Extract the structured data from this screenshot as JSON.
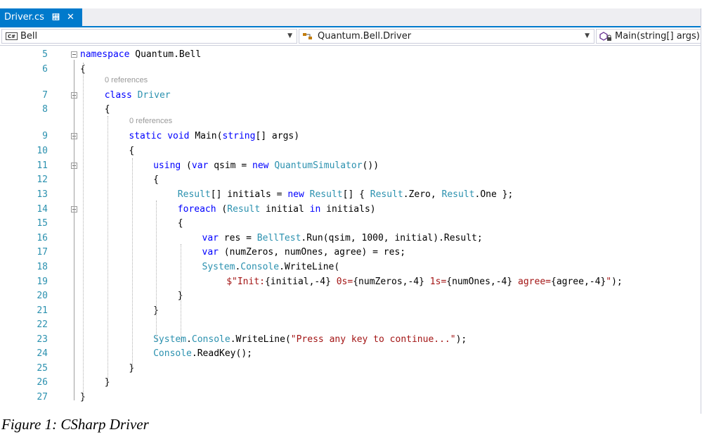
{
  "tab": {
    "label": "Driver.cs",
    "pin_icon": "pin-icon",
    "close_icon": "close-icon"
  },
  "navbar": {
    "project": "Bell",
    "project_icon": "csharp-project-icon",
    "class": "Quantum.Bell.Driver",
    "class_icon": "class-icon",
    "member": "Main(string[] args)",
    "member_icon": "method-icon"
  },
  "references": [
    "0 references",
    "0 references"
  ],
  "lines": [
    {
      "num": "5",
      "tokens": [
        {
          "t": "namespace",
          "c": "kw"
        },
        {
          "t": " Quantum.Bell"
        }
      ]
    },
    {
      "num": "6",
      "tokens": [
        {
          "t": "{"
        }
      ]
    },
    {
      "num": "7",
      "tokens": [
        {
          "t": "class",
          "c": "kw"
        },
        {
          "t": " "
        },
        {
          "t": "Driver",
          "c": "ty"
        }
      ]
    },
    {
      "num": "8",
      "tokens": [
        {
          "t": "{"
        }
      ]
    },
    {
      "num": "9",
      "tokens": [
        {
          "t": "static",
          "c": "kw"
        },
        {
          "t": " "
        },
        {
          "t": "void",
          "c": "kw"
        },
        {
          "t": " Main("
        },
        {
          "t": "string",
          "c": "kw"
        },
        {
          "t": "[] args)"
        }
      ]
    },
    {
      "num": "10",
      "tokens": [
        {
          "t": "{"
        }
      ]
    },
    {
      "num": "11",
      "tokens": [
        {
          "t": "using",
          "c": "kw"
        },
        {
          "t": " ("
        },
        {
          "t": "var",
          "c": "kw"
        },
        {
          "t": " qsim = "
        },
        {
          "t": "new",
          "c": "kw"
        },
        {
          "t": " "
        },
        {
          "t": "QuantumSimulator",
          "c": "ty"
        },
        {
          "t": "())"
        }
      ]
    },
    {
      "num": "12",
      "tokens": [
        {
          "t": "{"
        }
      ]
    },
    {
      "num": "13",
      "tokens": [
        {
          "t": "Result",
          "c": "ty"
        },
        {
          "t": "[] initials = "
        },
        {
          "t": "new",
          "c": "kw"
        },
        {
          "t": " "
        },
        {
          "t": "Result",
          "c": "ty"
        },
        {
          "t": "[] { "
        },
        {
          "t": "Result",
          "c": "ty"
        },
        {
          "t": ".Zero, "
        },
        {
          "t": "Result",
          "c": "ty"
        },
        {
          "t": ".One };"
        }
      ]
    },
    {
      "num": "14",
      "tokens": [
        {
          "t": "foreach",
          "c": "kw"
        },
        {
          "t": " ("
        },
        {
          "t": "Result",
          "c": "ty"
        },
        {
          "t": " initial "
        },
        {
          "t": "in",
          "c": "kw"
        },
        {
          "t": " initials)"
        }
      ]
    },
    {
      "num": "15",
      "tokens": [
        {
          "t": "{"
        }
      ]
    },
    {
      "num": "16",
      "tokens": [
        {
          "t": "var",
          "c": "kw"
        },
        {
          "t": " res = "
        },
        {
          "t": "BellTest",
          "c": "ty"
        },
        {
          "t": ".Run(qsim, 1000, initial).Result;"
        }
      ]
    },
    {
      "num": "17",
      "tokens": [
        {
          "t": "var",
          "c": "kw"
        },
        {
          "t": " (numZeros, numOnes, agree) = res;"
        }
      ]
    },
    {
      "num": "18",
      "tokens": [
        {
          "t": "System",
          "c": "ty"
        },
        {
          "t": "."
        },
        {
          "t": "Console",
          "c": "ty"
        },
        {
          "t": ".WriteLine("
        }
      ]
    },
    {
      "num": "19",
      "tokens": [
        {
          "t": "$\"Init:",
          "c": "str"
        },
        {
          "t": "{initial,-4}"
        },
        {
          "t": " 0s=",
          "c": "str"
        },
        {
          "t": "{numZeros,-4}"
        },
        {
          "t": " 1s=",
          "c": "str"
        },
        {
          "t": "{numOnes,-4}"
        },
        {
          "t": " agree=",
          "c": "str"
        },
        {
          "t": "{agree,-4}"
        },
        {
          "t": "\"",
          "c": "str"
        },
        {
          "t": ");"
        }
      ]
    },
    {
      "num": "20",
      "tokens": [
        {
          "t": "}"
        }
      ]
    },
    {
      "num": "21",
      "tokens": [
        {
          "t": "}"
        }
      ]
    },
    {
      "num": "22",
      "tokens": []
    },
    {
      "num": "23",
      "tokens": [
        {
          "t": "System",
          "c": "ty"
        },
        {
          "t": "."
        },
        {
          "t": "Console",
          "c": "ty"
        },
        {
          "t": ".WriteLine("
        },
        {
          "t": "\"Press any key to continue...\"",
          "c": "str"
        },
        {
          "t": ");"
        }
      ]
    },
    {
      "num": "24",
      "tokens": [
        {
          "t": "Console",
          "c": "ty"
        },
        {
          "t": ".ReadKey();"
        }
      ]
    },
    {
      "num": "25",
      "tokens": [
        {
          "t": "}"
        }
      ]
    },
    {
      "num": "26",
      "tokens": [
        {
          "t": "}"
        }
      ]
    },
    {
      "num": "27",
      "tokens": [
        {
          "t": "}"
        }
      ]
    }
  ],
  "caption": "Figure 1:  CSharp Driver"
}
